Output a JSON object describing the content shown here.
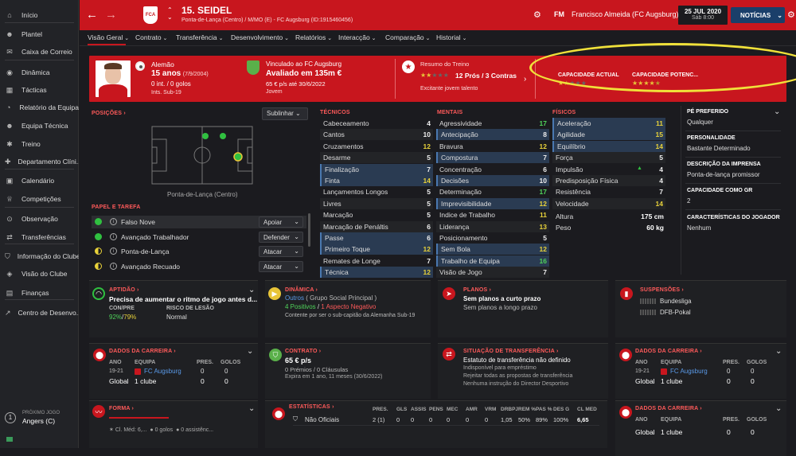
{
  "sidebar": {
    "items": [
      {
        "label": "Início",
        "icon": "home-icon",
        "glyph": "⌂"
      },
      {
        "label": "Plantel",
        "icon": "squad-icon",
        "glyph": "☻"
      },
      {
        "label": "Caixa de Correio",
        "icon": "mail-icon",
        "glyph": "✉"
      },
      {
        "label": "Dinâmica",
        "icon": "dynamics-icon",
        "glyph": "◉"
      },
      {
        "label": "Tácticas",
        "icon": "tactics-icon",
        "glyph": "▦"
      },
      {
        "label": "Relatório da Equipa",
        "icon": "report-icon",
        "glyph": "◔"
      },
      {
        "label": "Equipa Técnica",
        "icon": "staff-icon",
        "glyph": "☻"
      },
      {
        "label": "Treino",
        "icon": "training-icon",
        "glyph": "✱"
      },
      {
        "label": "Departamento Clíni...",
        "icon": "medical-icon",
        "glyph": "✚"
      },
      {
        "label": "Calendário",
        "icon": "calendar-icon",
        "glyph": "▣"
      },
      {
        "label": "Competições",
        "icon": "trophy-icon",
        "glyph": "♕"
      },
      {
        "label": "Observação",
        "icon": "scouting-icon",
        "glyph": "⊙"
      },
      {
        "label": "Transferências",
        "icon": "transfers-icon",
        "glyph": "⇄"
      },
      {
        "label": "Informação do Clube",
        "icon": "club-info-icon",
        "glyph": "⛉"
      },
      {
        "label": "Visão do Clube",
        "icon": "club-vision-icon",
        "glyph": "◈"
      },
      {
        "label": "Finanças",
        "icon": "finances-icon",
        "glyph": "▤"
      },
      {
        "label": "Centro de Desenvo...",
        "icon": "development-icon",
        "glyph": "↗"
      }
    ],
    "next_match_label": "PRÓXIMO JOGO",
    "next_match": "Angers (C)"
  },
  "topbar": {
    "player_name": "15. SEIDEL",
    "player_sub": "Ponta-de-Lança (Centro) / M/MO (E) - FC Augsburg (ID:1915460456)",
    "manager_prefix": "FM",
    "manager": "Francisco Almeida (FC Augsburg)",
    "date": "25 JUL 2020",
    "time": "Sáb 8:00",
    "news": "NOTÍCIAS",
    "accent": "#c8161e"
  },
  "tabs": [
    "Visão Geral",
    "Contrato",
    "Transferência",
    "Desenvolvimento",
    "Relatórios",
    "Interacção",
    "Comparação",
    "Historial"
  ],
  "banner": {
    "nationality": "Alemão",
    "age": "15 anos",
    "dob": "(7/9/2004)",
    "caps": "0 int. / 0 golos",
    "youth": "Ints. Sub-19",
    "contract_title": "Vinculado ao FC Augsburg",
    "value": "Avaliado em 135m €",
    "wage": "65 € p/s até 30/6/2022",
    "status": "Jovem",
    "club_badge": "FCA",
    "training_title": "Resumo do Treino",
    "training_score": "12 Prós / 3 Contras",
    "training_note": "Excitante jovem talento",
    "ca_label": "CAPACIDADE ACTUAL",
    "pa_label": "CAPACIDADE POTENC...",
    "ca_stars": 1.5,
    "pa_stars": 4.5
  },
  "positions": {
    "title": "POSIÇÕES",
    "dropdown": "Sublinhar",
    "pitch_label": "Ponta-de-Lança (Centro)"
  },
  "roles": {
    "title": "PAPEL E TAREFA",
    "items": [
      {
        "name": "Falso Nove",
        "duty": "Apoiar",
        "dot": "green"
      },
      {
        "name": "Avançado Trabalhador",
        "duty": "Defender",
        "dot": "green"
      },
      {
        "name": "Ponta-de-Lança",
        "duty": "Atacar",
        "dot": "half"
      },
      {
        "name": "Avançado Recuado",
        "duty": "Atacar",
        "dot": "half"
      }
    ]
  },
  "technical": {
    "title": "TÉCNICOS",
    "attrs": [
      {
        "n": "Cabeceamento",
        "v": "4"
      },
      {
        "n": "Cantos",
        "v": "10"
      },
      {
        "n": "Cruzamentos",
        "v": "12"
      },
      {
        "n": "Desarme",
        "v": "5"
      },
      {
        "n": "Finalização",
        "v": "7"
      },
      {
        "n": "Finta",
        "v": "14"
      },
      {
        "n": "Lançamentos Longos",
        "v": "5"
      },
      {
        "n": "Livres",
        "v": "5"
      },
      {
        "n": "Marcação",
        "v": "5"
      },
      {
        "n": "Marcação de Penáltis",
        "v": "6"
      },
      {
        "n": "Passe",
        "v": "6"
      },
      {
        "n": "Primeiro Toque",
        "v": "12"
      },
      {
        "n": "Remates de Longe",
        "v": "7"
      },
      {
        "n": "Técnica",
        "v": "12"
      }
    ]
  },
  "mental": {
    "title": "MENTAIS",
    "attrs": [
      {
        "n": "Agressividade",
        "v": "17"
      },
      {
        "n": "Antecipação",
        "v": "8"
      },
      {
        "n": "Bravura",
        "v": "12"
      },
      {
        "n": "Compostura",
        "v": "7"
      },
      {
        "n": "Concentração",
        "v": "6"
      },
      {
        "n": "Decisões",
        "v": "10"
      },
      {
        "n": "Determinação",
        "v": "17"
      },
      {
        "n": "Imprevisibilidade",
        "v": "12"
      },
      {
        "n": "Indice de Trabalho",
        "v": "11"
      },
      {
        "n": "Liderança",
        "v": "13"
      },
      {
        "n": "Posicionamento",
        "v": "5"
      },
      {
        "n": "Sem Bola",
        "v": "12"
      },
      {
        "n": "Trabalho de Equipa",
        "v": "16"
      },
      {
        "n": "Visão de Jogo",
        "v": "7"
      }
    ]
  },
  "physical": {
    "title": "FÍSICOS",
    "attrs": [
      {
        "n": "Aceleração",
        "v": "11"
      },
      {
        "n": "Agilidade",
        "v": "15"
      },
      {
        "n": "Equilíbrio",
        "v": "14"
      },
      {
        "n": "Força",
        "v": "5"
      },
      {
        "n": "Impulsão",
        "v": "4"
      },
      {
        "n": "Predisposição Física",
        "v": "4"
      },
      {
        "n": "Resistência",
        "v": "7"
      },
      {
        "n": "Velocidade",
        "v": "14"
      }
    ],
    "height_label": "Altura",
    "height": "175 cm",
    "weight_label": "Peso",
    "weight": "60 kg"
  },
  "info": {
    "foot_label": "PÉ PREFERIDO",
    "foot": "Qualquer",
    "personality_label": "PERSONALIDADE",
    "personality": "Bastante Determinado",
    "press_label": "DESCRIÇÃO DA IMPRENSA",
    "press": "Ponta-de-lança promissor",
    "gr_label": "CAPACIDADE COMO GR",
    "gr": "2",
    "traits_label": "CARACTERÍSTICAS DO JOGADOR",
    "traits": "Nenhum"
  },
  "cards": {
    "aptidao": {
      "title": "APTIDÃO",
      "text": "Precisa de aumentar o ritmo de jogo antes d...",
      "conpre_label": "CON/PRE",
      "conpre_a": "92%",
      "conpre_b": "79%",
      "risk_label": "RISCO DE LESÃO",
      "risk": "Normal"
    },
    "dinamica": {
      "title": "DINÂMICA",
      "line1_a": "Outros",
      "line1_b": " ( Grupo Social Principal )",
      "pos": "4 Positivos",
      "neg": "1 Aspecto Negativo",
      "note": "Contente por ser o sub-capitão da Alemanha Sub-19"
    },
    "planos": {
      "title": "PLANOS",
      "line1": "Sem planos a curto prazo",
      "line2": "Sem planos a longo prazo"
    },
    "suspensoes": {
      "title": "SUSPENSÕES",
      "c1": "Bundesliga",
      "c2": "DFB-Pokal"
    },
    "carreira1": {
      "title": "DADOS DA CARREIRA",
      "h1": "ANO",
      "h2": "EQUIPA",
      "h3": "PRES.",
      "h4": "GOLOS",
      "season": "19-21",
      "team": "FC Augsburg",
      "apps": "0",
      "goals": "0",
      "total": "Global",
      "clubs": "1 clube",
      "tapps": "0",
      "tgoals": "0"
    },
    "contrato": {
      "title": "CONTRATO",
      "wage": "65 € p/s",
      "clauses": "0 Prémios / 0 Cláusulas",
      "expiry": "Expira em 1 ano, 11 meses (30/6/2022)"
    },
    "transfer": {
      "title": "SITUAÇÃO DE TRANSFERÊNCIA",
      "l1": "Estatuto de transferência não definido",
      "l2": "Indisponível para empréstimo",
      "l3": "Rejeitar todas as propostas de transferência",
      "l4": "Nenhuma instrução do Director Desportivo"
    },
    "carreira2": {
      "title": "DADOS DA CARREIRA",
      "h1": "ANO",
      "h2": "EQUIPA",
      "h3": "PRES.",
      "h4": "GOLOS",
      "season": "19-21",
      "team": "FC Augsburg",
      "apps": "0",
      "goals": "0",
      "total": "Global",
      "clubs": "1 clube",
      "tapps": "0",
      "tgoals": "0"
    },
    "forma": {
      "title": "FORMA",
      "avg": "Cl. Méd: 6,...",
      "goals": "0 golos",
      "assists": "0 assistênc..."
    },
    "estatisticas": {
      "title": "ESTATÍSTICAS",
      "headers": [
        "PRES.",
        "GLS",
        "ASSIS",
        "PENS",
        "MEC",
        "AMR",
        "VRM",
        "DRBPJ",
        "REM %",
        "PAS %",
        "DES G",
        "CL MED"
      ],
      "row_label": "Não Oficiais",
      "row": [
        "2 (1)",
        "0",
        "0",
        "0",
        "0",
        "0",
        "0",
        "1,05",
        "50%",
        "89%",
        "100%",
        "6,65"
      ]
    },
    "carreira3": {
      "title": "DADOS DA CARREIRA",
      "h1": "ANO",
      "h2": "EQUIPA",
      "h3": "PRES.",
      "h4": "GOLOS",
      "total": "Global",
      "clubs": "1 clube",
      "tapps": "0",
      "tgoals": "0"
    }
  }
}
